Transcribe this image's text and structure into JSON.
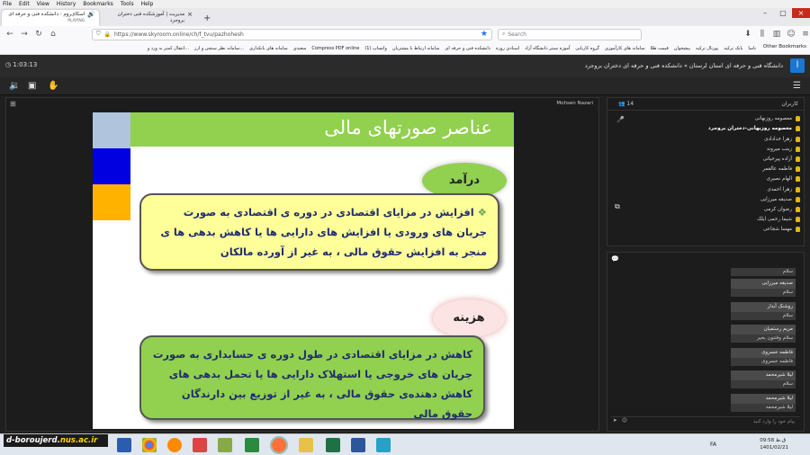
{
  "firefox": {
    "menu": [
      "File",
      "Edit",
      "View",
      "History",
      "Bookmarks",
      "Tools",
      "Help"
    ],
    "tabs": [
      {
        "title": "اسکای‌روم - دانشکده فنی و حرفه ای",
        "sub": "PLAYING"
      },
      {
        "title": "مدیریت | آموزشکده فنی دختران بروجرد"
      }
    ],
    "url": "https://www.skyroom.online/ch/f_tvu/pazhohesh",
    "search_placeholder": "Search",
    "bookmarks": [
      "ناسا",
      "بانک ترکیه",
      "پورتال ترکیه",
      "پیشخوان",
      "قیمت طلا",
      "سامانه های کارآموزی",
      "گروه کاریابی",
      "آموزه سنتر دانشگاه آزاد",
      "اسنادی روزه",
      "دانشکده فنی و حرفه ای",
      "سامانه ارتباط با مشتریان",
      "(1) واتساپ",
      "Compress PDF online",
      "سعیدی",
      "سامانه های بانکداری",
      "سامانه نظر سنجی و ارز...",
      "انتقال کمتر به ورد و..."
    ],
    "other_bookmarks": "Other Bookmarks"
  },
  "skyroom": {
    "timer": "1:03:13",
    "breadcrumb": "دانشگاه فنی و حرفه ای استان لرستان » دانشکده فنی و حرفه ای دختران بروجرد",
    "presenter": "Mohsen Nazari",
    "slide": {
      "title": "عناصر صورتهای مالی",
      "income_label": "درآمد",
      "income_text": "افزایش در مزایای اقتصادی در دوره ی اقتصادی به صورت جریان های ورودی یا افزایش های دارایی ها یا کاهش بدهی ها ی منجر به افزایش حقوق مالی ، به غیر از آورده مالکان",
      "expense_label": "هزینه",
      "expense_text": "کاهش در مزایای اقتصادی در طول دوره ی حسابداری به صورت جریان های خروجی یا استهلاک دارایی ها یا تحمل بدهی های کاهش دهنده‌ی حقوق مالی ، به غیر از توزیع بین دارندگان حقوق مالی",
      "square_colors": [
        "#b0c4de",
        "#0000e0",
        "#ffb300"
      ]
    },
    "users": {
      "label": "کاربران",
      "count": "14",
      "list": [
        "معصومه روزبهانی",
        "معصومه روزبهانی-دختران بروجرد",
        "زهرا خدادادی",
        "زینب میروند",
        "آزاده پیرحیاتی",
        "فاطمه عالقمر",
        "الهام نصیری",
        "زهرا احمدی",
        "صدیقه میرزایی",
        "رضوان کرمی",
        "شیما رحمی ایلک",
        "مهسا شجاعی"
      ]
    },
    "chat": {
      "messages": [
        {
          "name": "",
          "text": "سلام"
        },
        {
          "name": "صدیقه میرزایی",
          "text": "سلام"
        },
        {
          "name": "روشنک آبدار",
          "text": "سلام"
        },
        {
          "name": "مریم رستمیان",
          "text": "سلام وقتتون بخیر"
        },
        {
          "name": "فاطمه خسروی",
          "text": "فاطمه خسروی"
        },
        {
          "name": "لیلا شیرمحمد",
          "text": "سلام"
        },
        {
          "name": "لیلا شیرمحمد",
          "text": "لیلا شیرمحمد"
        }
      ],
      "input_placeholder": "پیام خود را وارد کنید"
    }
  },
  "taskbar": {
    "watermark_a": "d-boroujerd.",
    "watermark_b": "nus.ac.ir",
    "lang": "FA",
    "time": "09:58 ق.ظ",
    "date": "1401/02/21"
  }
}
